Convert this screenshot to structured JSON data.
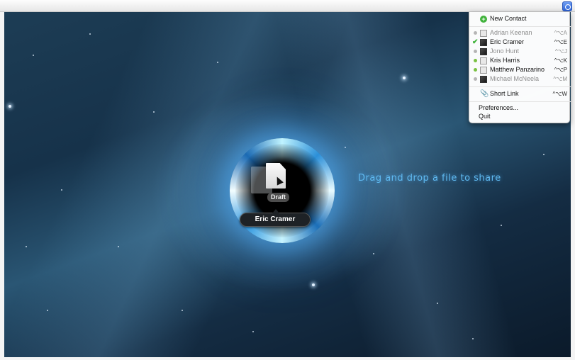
{
  "menu": {
    "new_contact": "New Contact",
    "contacts": [
      {
        "name": "Adrian Keenan",
        "shortcut": "^⌥A",
        "status": "offline",
        "checked": false,
        "photo": false
      },
      {
        "name": "Eric Cramer",
        "shortcut": "^⌥E",
        "status": "selected",
        "checked": true,
        "photo": true
      },
      {
        "name": "Jono Hunt",
        "shortcut": "^⌥J",
        "status": "offline",
        "checked": false,
        "photo": true
      },
      {
        "name": "Kris Harris",
        "shortcut": "^⌥K",
        "status": "online",
        "checked": false,
        "photo": false
      },
      {
        "name": "Matthew Panzarino",
        "shortcut": "^⌥P",
        "status": "online",
        "checked": false,
        "photo": false
      },
      {
        "name": "Michael McNeela",
        "shortcut": "^⌥M",
        "status": "offline",
        "checked": false,
        "photo": true
      }
    ],
    "short_link": "Short Link",
    "short_link_shortcut": "^⌥W",
    "preferences": "Preferences...",
    "quit": "Quit"
  },
  "drop_area": {
    "hint": "Drag and drop a file to share",
    "file_label": "Draft",
    "target_contact": "Eric Cramer"
  },
  "colors": {
    "online": "#7ac143",
    "offline": "#b5b5b5",
    "accent": "#5fb9f0"
  },
  "icons": {
    "status_item": "app-status-icon",
    "new_contact": "plus-icon",
    "short_link": "paperclip-icon"
  }
}
